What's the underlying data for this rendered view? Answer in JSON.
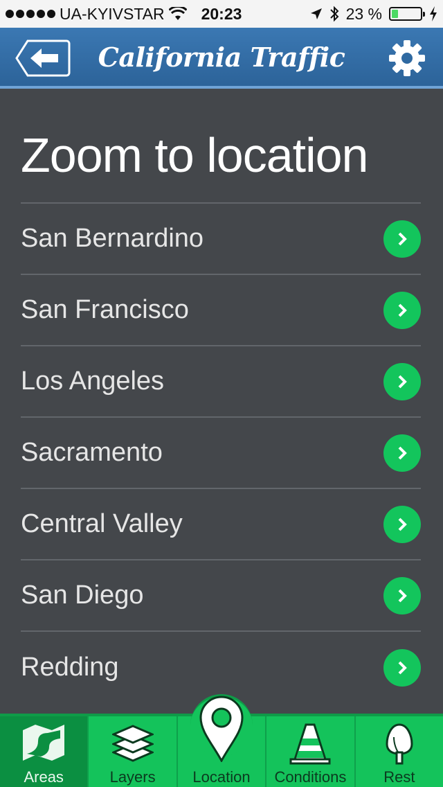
{
  "status_bar": {
    "carrier": "UA-KYIVSTAR",
    "time": "20:23",
    "battery_text": "23 %",
    "battery_level": 0.23
  },
  "header": {
    "title": "California Traffic",
    "back_icon": "back-arrow-icon",
    "settings_icon": "gear-icon"
  },
  "main": {
    "section_title": "Zoom to location",
    "locations": [
      {
        "name": "San Bernardino"
      },
      {
        "name": "San Francisco"
      },
      {
        "name": "Los Angeles"
      },
      {
        "name": "Sacramento"
      },
      {
        "name": "Central Valley"
      },
      {
        "name": "San Diego"
      },
      {
        "name": "Redding"
      }
    ]
  },
  "tabs": [
    {
      "label": "Areas",
      "icon": "map-icon",
      "active": true
    },
    {
      "label": "Layers",
      "icon": "layers-icon",
      "active": false
    },
    {
      "label": "Location",
      "icon": "location-pin-icon",
      "active": false
    },
    {
      "label": "Conditions",
      "icon": "traffic-cone-icon",
      "active": false
    },
    {
      "label": "Rest",
      "icon": "tree-icon",
      "active": false
    }
  ],
  "colors": {
    "header_blue": "#2c6399",
    "background": "#44474b",
    "accent_green": "#13c55c",
    "active_tab": "#0b8f41"
  }
}
